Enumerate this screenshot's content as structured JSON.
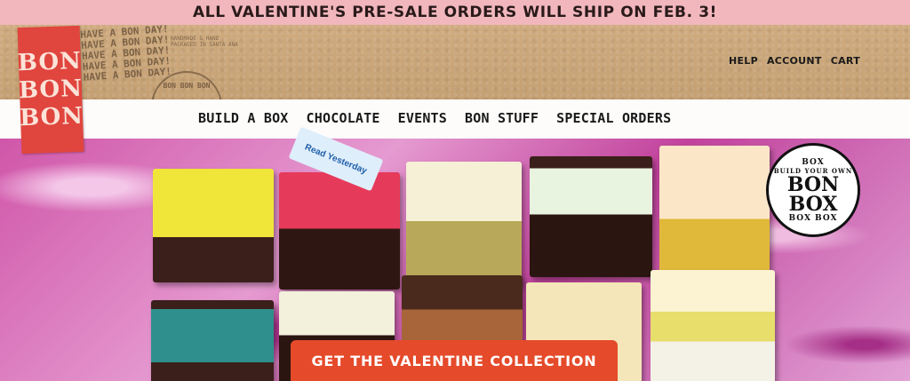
{
  "announcement": "ALL VALENTINE'S PRE-SALE ORDERS WILL SHIP ON FEB. 3!",
  "logo": {
    "lines": [
      "BON",
      "BON",
      "BON"
    ]
  },
  "stamp": {
    "lines": [
      "HAVE A BON DAY!",
      "HAVE A BON DAY!",
      "HAVE A BON DAY!",
      "HAVE A BON DAY!",
      "HAVE A BON DAY!"
    ],
    "note": "HANDMADE & HAND PACKAGED IN SANTA ANA",
    "round": "BON BON BON"
  },
  "util_nav": {
    "help": "HELP",
    "account": "ACCOUNT",
    "cart": "CART"
  },
  "main_nav": {
    "build_a_box": "BUILD A BOX",
    "chocolate": "CHOCOLATE",
    "events": "EVENTS",
    "bon_stuff": "BON STUFF",
    "special_orders": "SPECIAL ORDERS"
  },
  "hero": {
    "tag_text": "Read Yesterday",
    "badge": {
      "top": "BOX",
      "ring": "BUILD YOUR OWN",
      "main1": "BON",
      "main2": "BOX",
      "side": "BOX BOX"
    },
    "cta": "GET THE VALENTINE COLLECTION"
  },
  "colors": {
    "announce_bg": "#f1b7bd",
    "kraft": "#c9a679",
    "logo_red": "#e0453e",
    "cta": "#e54a2a",
    "hero_pink": "#d056a9"
  }
}
